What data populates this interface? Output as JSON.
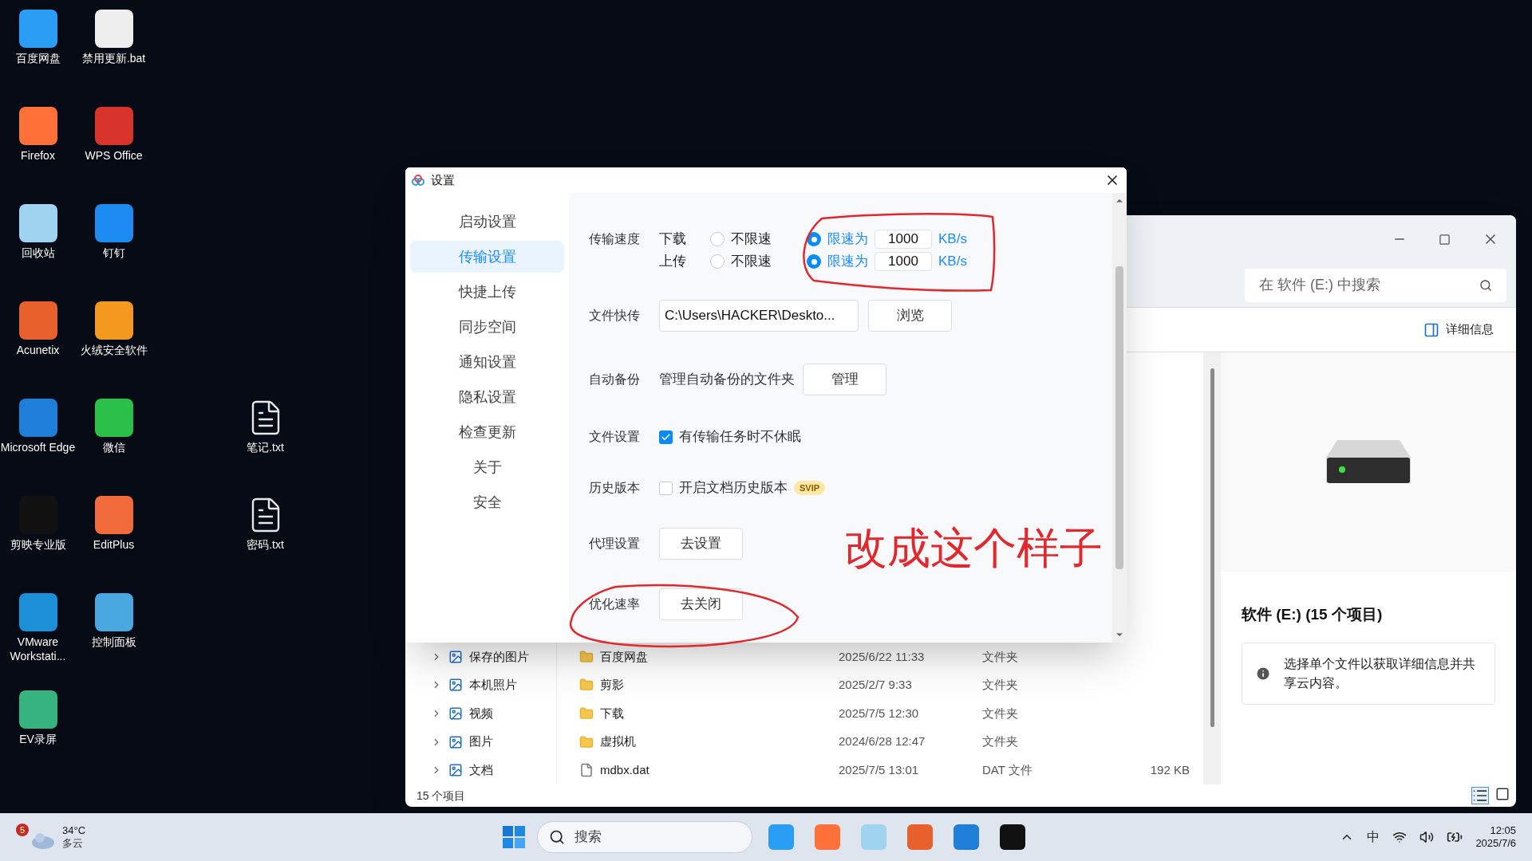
{
  "desktop_columns": [
    [
      {
        "label": "百度网盘"
      },
      {
        "label": "Firefox"
      },
      {
        "label": "回收站"
      },
      {
        "label": "Acunetix"
      },
      {
        "label": "Microsoft Edge"
      },
      {
        "label": "剪映专业版"
      },
      {
        "label": "VMware Workstati..."
      },
      {
        "label": "EV录屏"
      }
    ],
    [
      {
        "label": "禁用更新.bat"
      },
      {
        "label": "WPS Office"
      },
      {
        "label": "钉钉"
      },
      {
        "label": "火绒安全软件"
      },
      {
        "label": "微信"
      },
      {
        "label": "EditPlus"
      },
      {
        "label": "控制面板"
      }
    ]
  ],
  "desktop_files": [
    {
      "label": "笔记.txt"
    },
    {
      "label": "密码.txt"
    }
  ],
  "explorer": {
    "search": {
      "placeholder": "在 软件 (E:) 中搜索"
    },
    "details_button": "详细信息",
    "tree": [
      {
        "label": "保存的图片"
      },
      {
        "label": "本机照片"
      },
      {
        "label": "视频"
      },
      {
        "label": "图片"
      },
      {
        "label": "文档"
      }
    ],
    "files": [
      {
        "kind": "folder",
        "name": "百度网盘",
        "date": "2025/6/22 11:33",
        "type": "文件夹"
      },
      {
        "kind": "folder",
        "name": "剪影",
        "date": "2025/2/7 9:33",
        "type": "文件夹"
      },
      {
        "kind": "folder",
        "name": "下载",
        "date": "2025/7/5 12:30",
        "type": "文件夹"
      },
      {
        "kind": "folder",
        "name": "虚拟机",
        "date": "2024/6/28 12:47",
        "type": "文件夹"
      },
      {
        "kind": "file",
        "name": "mdbx.dat",
        "date": "2025/7/5 13:01",
        "type": "DAT 文件",
        "size": "192 KB"
      }
    ],
    "status": "15 个项目",
    "details": {
      "title": "软件 (E:) (15 个项目)",
      "info": "选择单个文件以获取详细信息并共享云内容。"
    }
  },
  "settings": {
    "title": "设置",
    "nav": [
      {
        "label": "启动设置",
        "selected": false
      },
      {
        "label": "传输设置",
        "selected": true
      },
      {
        "label": "快捷上传",
        "selected": false
      },
      {
        "label": "同步空间",
        "selected": false
      },
      {
        "label": "通知设置",
        "selected": false
      },
      {
        "label": "隐私设置",
        "selected": false
      },
      {
        "label": "检查更新",
        "selected": false
      },
      {
        "label": "关于",
        "selected": false
      },
      {
        "label": "安全",
        "selected": false
      }
    ],
    "speed": {
      "label": "传输速度",
      "rows": [
        {
          "direction": "下载",
          "options": [
            {
              "label": "不限速",
              "selected": false
            },
            {
              "label": "限速为",
              "selected": true,
              "value": "1000",
              "unit": "KB/s"
            }
          ]
        },
        {
          "direction": "上传",
          "options": [
            {
              "label": "不限速",
              "selected": false
            },
            {
              "label": "限速为",
              "selected": true,
              "value": "1000",
              "unit": "KB/s"
            }
          ]
        }
      ]
    },
    "quick_transfer": {
      "label": "文件快传",
      "path": "C:\\Users\\HACKER\\Deskto...",
      "button": "浏览"
    },
    "auto_backup": {
      "label": "自动备份",
      "text": "管理自动备份的文件夹",
      "button": "管理"
    },
    "file_setting": {
      "label": "文件设置",
      "checkbox": {
        "label": "有传输任务时不休眠",
        "checked": true
      }
    },
    "history": {
      "label": "历史版本",
      "checkbox": {
        "label": "开启文档历史版本",
        "checked": false
      },
      "badge": "SVIP"
    },
    "proxy": {
      "label": "代理设置",
      "button": "去设置"
    },
    "optimize": {
      "label": "优化速率",
      "button": "去关闭"
    }
  },
  "annotation": {
    "text": "改成这个样子"
  },
  "taskbar": {
    "weather": {
      "badge": "5",
      "temp": "34°C",
      "condition": "多云"
    },
    "search": {
      "placeholder": "搜索"
    },
    "ime": "中",
    "time": "12:05",
    "date": "2025/7/6"
  }
}
